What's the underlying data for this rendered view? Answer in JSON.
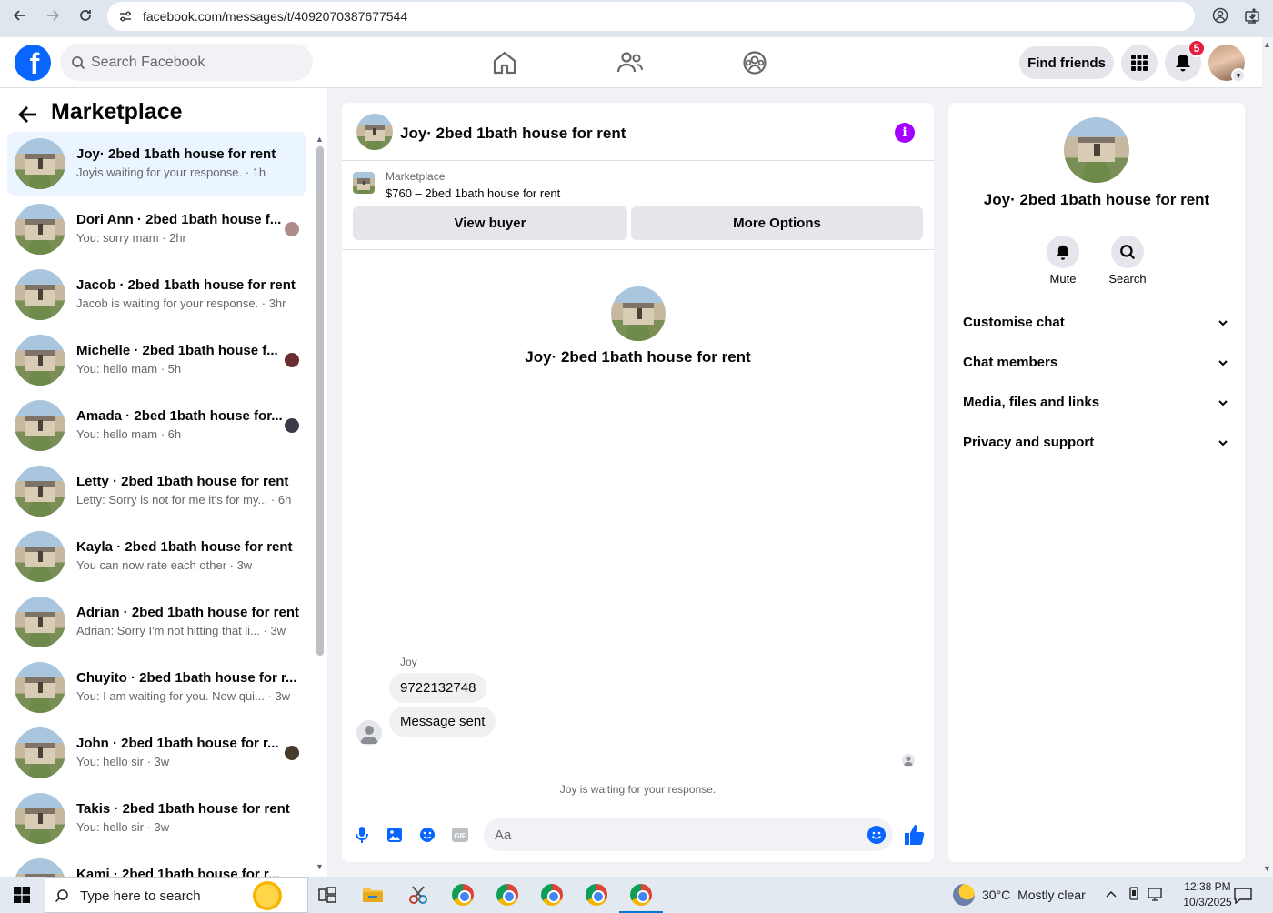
{
  "browser": {
    "url": "facebook.com/messages/t/4092070387677544"
  },
  "fb": {
    "search_placeholder": "Search Facebook",
    "find_friends": "Find friends",
    "notification_count": "5",
    "brand_color": "#0866ff"
  },
  "sidebar": {
    "title": "Marketplace",
    "conversations": [
      {
        "name": "Joy· 2bed 1bath house for rent",
        "preview": "Joyis waiting for your response. · 1h",
        "active": true
      },
      {
        "name": "Dori Ann · 2bed 1bath house f...",
        "preview": "You: sorry mam · 2hr"
      },
      {
        "name": "Jacob · 2bed 1bath house for rent",
        "preview": "Jacob is waiting for your response. · 3hr"
      },
      {
        "name": "Michelle · 2bed 1bath house f...",
        "preview": "You: hello mam · 5h"
      },
      {
        "name": "Amada · 2bed 1bath house for...",
        "preview": "You: hello mam · 6h"
      },
      {
        "name": "Letty · 2bed 1bath house for rent",
        "preview": "Letty: Sorry is not for me it's for my... · 6h"
      },
      {
        "name": "Kayla · 2bed 1bath house for rent",
        "preview": "You can now rate each other · 3w"
      },
      {
        "name": "Adrian · 2bed 1bath house for rent",
        "preview": "Adrian: Sorry I'm not hitting that li...  · 3w"
      },
      {
        "name": "Chuyito · 2bed 1bath house for r...",
        "preview": "You: I am waiting for you. Now qui... · 3w"
      },
      {
        "name": "John · 2bed 1bath house for r...",
        "preview": "You: hello sir · 3w"
      },
      {
        "name": "Takis · 2bed 1bath house for rent",
        "preview": "You: hello sir · 3w"
      },
      {
        "name": "Kami · 2bed 1bath house for r...",
        "preview": ""
      }
    ]
  },
  "chat": {
    "title": "Joy· 2bed 1bath house for rent",
    "marketplace_label": "Marketplace",
    "listing": "$760 – 2bed 1bath house for rent",
    "view_buyer": "View buyer",
    "more_options": "More Options",
    "center_name": "Joy· 2bed 1bath house for rent",
    "sender": "Joy",
    "messages": [
      "9722132748",
      "Message sent"
    ],
    "waiting": "Joy is waiting for your response.",
    "composer_placeholder": "Aa",
    "accent_color": "#a400ff"
  },
  "panel": {
    "name": "Joy· 2bed 1bath house for rent",
    "mute": "Mute",
    "search": "Search",
    "sections": [
      "Customise chat",
      "Chat members",
      "Media, files and links",
      "Privacy and support"
    ]
  },
  "taskbar": {
    "search_placeholder": "Type here to search",
    "temperature": "30°C",
    "weather": "Mostly clear",
    "time": "12:38 PM",
    "date": "10/3/2025"
  }
}
